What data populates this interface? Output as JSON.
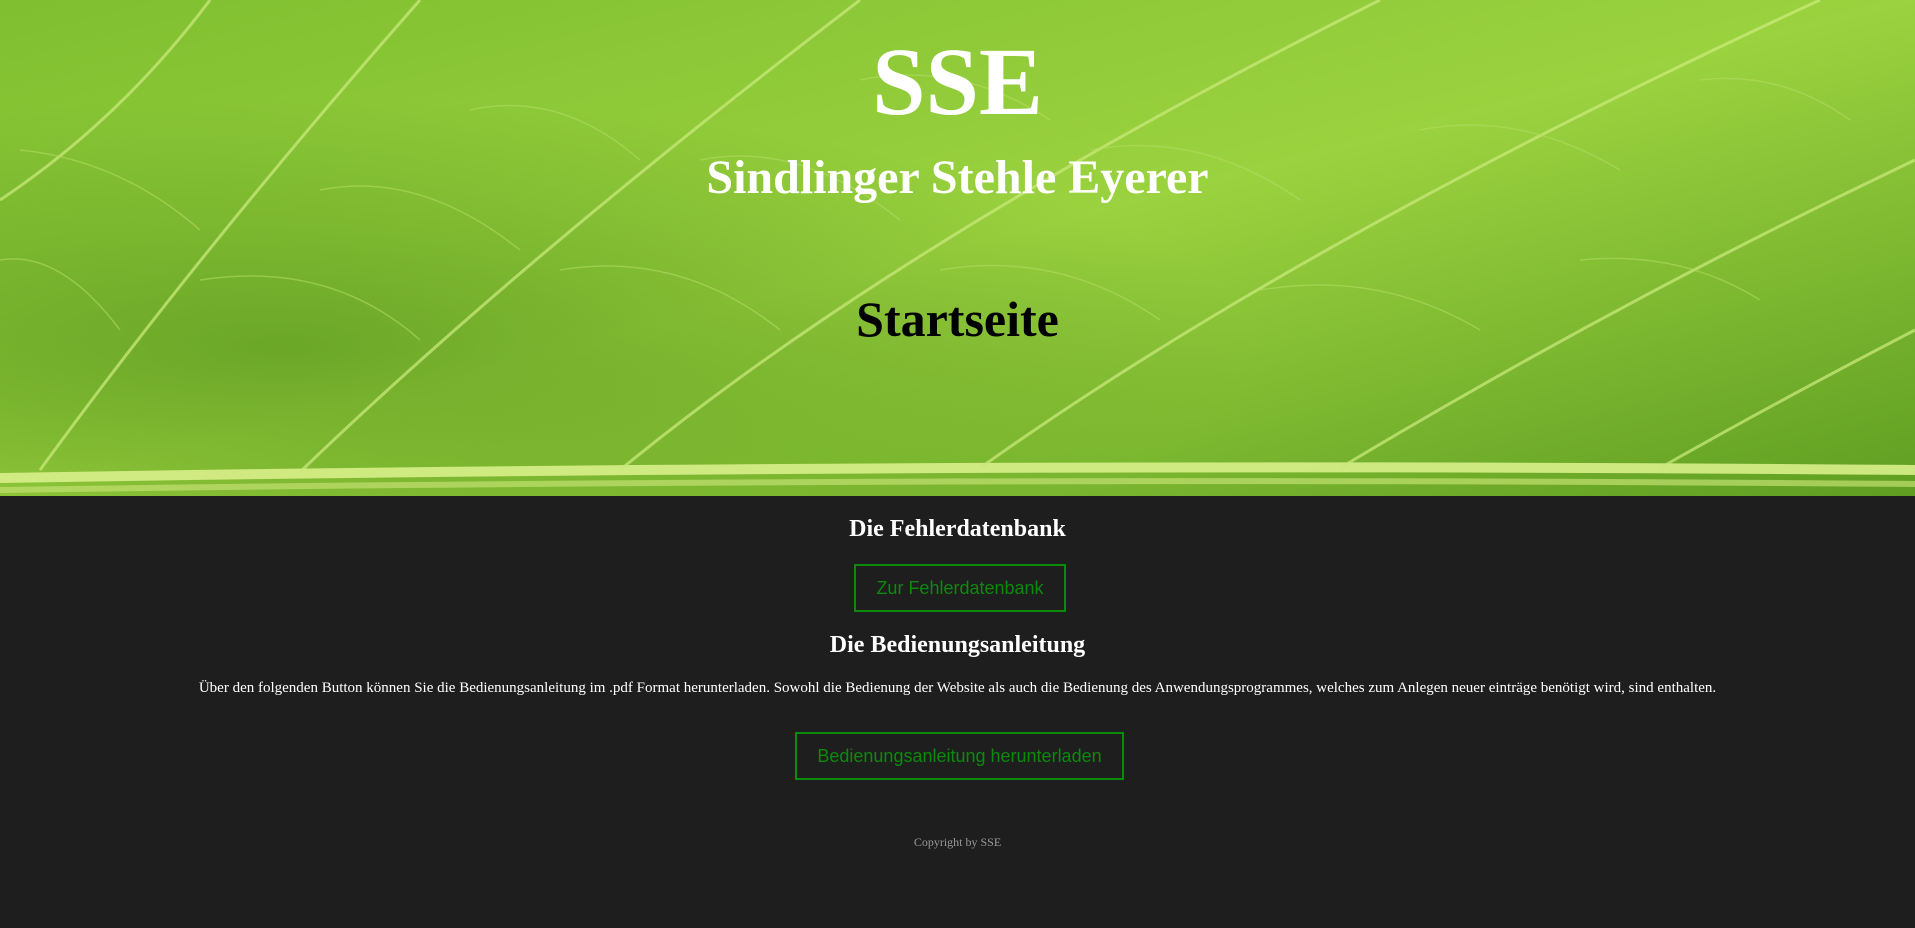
{
  "header": {
    "brand": "SSE",
    "brand_subtitle": "Sindlinger Stehle Eyerer",
    "page_title": "Startseite"
  },
  "sections": {
    "database": {
      "heading": "Die Fehlerdatenbank",
      "button_label": "Zur Fehlerdatenbank"
    },
    "manual": {
      "heading": "Die Bedienungsanleitung",
      "description": "Über den folgenden Button können Sie die Bedienungsanleitung im .pdf Format herunterladen. Sowohl die Bedienung der Website als auch die Bedienung des Anwendungsprogrammes, welches zum Anlegen neuer einträge benötigt wird, sind enthalten.",
      "button_label": "Bedienungsanleitung herunterladen"
    }
  },
  "footer": {
    "copyright": "Copyright by SSE"
  },
  "colors": {
    "background": "#1e1e1e",
    "accent": "#0c8a0c",
    "text": "#ffffff",
    "muted": "#9a9a9a"
  }
}
